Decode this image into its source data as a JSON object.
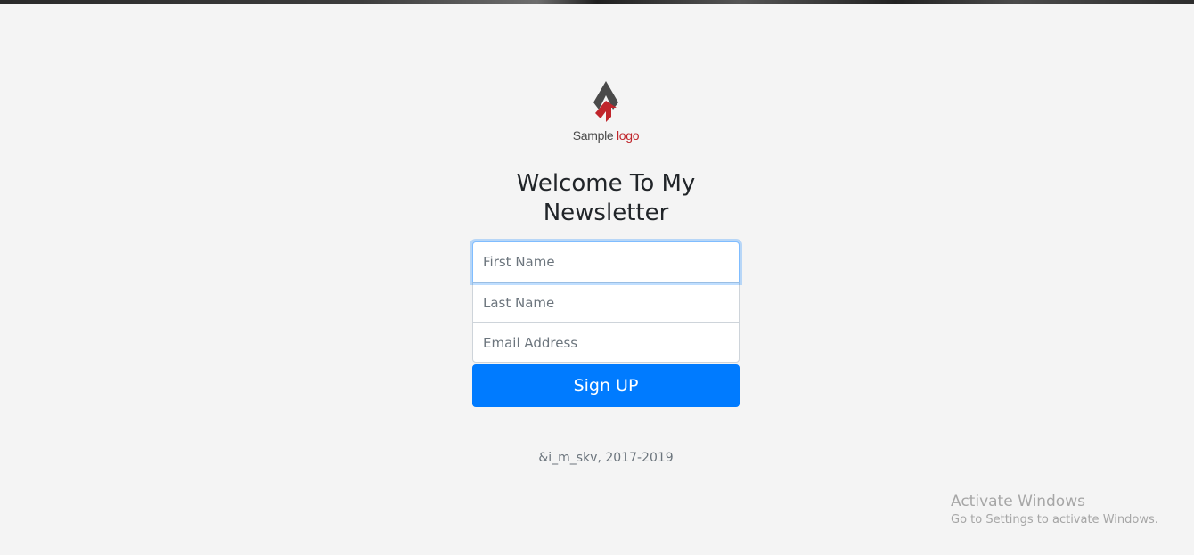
{
  "logo": {
    "text_primary": "Sample",
    "text_accent": "logo",
    "icon": "sample-logo-chevron",
    "colors": {
      "dark": "#4a4a4a",
      "accent": "#c0252b"
    }
  },
  "heading": "Welcome To My Newsletter",
  "form": {
    "first_name_placeholder": "First Name",
    "last_name_placeholder": "Last Name",
    "email_placeholder": "Email Address",
    "submit_label": "Sign UP"
  },
  "footer": "&i_m_skv, 2017-2019",
  "watermark": {
    "title": "Activate Windows",
    "subtitle": "Go to Settings to activate Windows."
  },
  "colors": {
    "background": "#f4f4f4",
    "primary_button": "#007bff",
    "focus_border": "#80bdff"
  }
}
